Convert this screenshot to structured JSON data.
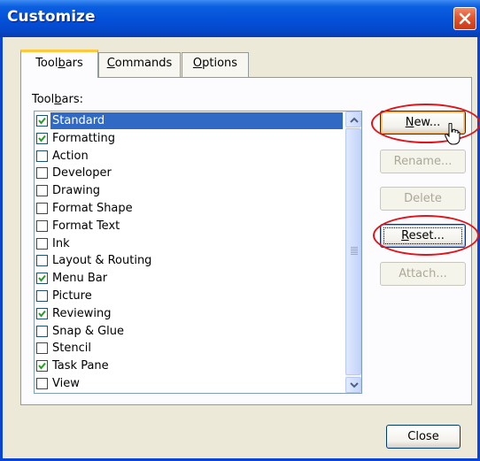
{
  "window": {
    "title": "Customize"
  },
  "tabs": [
    {
      "label_pre": "Tool",
      "label_ul": "b",
      "label_post": "ars",
      "active": true
    },
    {
      "label_pre": "",
      "label_ul": "C",
      "label_post": "ommands",
      "active": false
    },
    {
      "label_pre": "",
      "label_ul": "O",
      "label_post": "ptions",
      "active": false
    }
  ],
  "panel": {
    "list_label_pre": "Tool",
    "list_label_ul": "b",
    "list_label_post": "ars:"
  },
  "toolbars": [
    {
      "label": "Standard",
      "checked": true,
      "selected": true
    },
    {
      "label": "Formatting",
      "checked": true
    },
    {
      "label": "Action",
      "checked": false
    },
    {
      "label": "Developer",
      "checked": false
    },
    {
      "label": "Drawing",
      "checked": false
    },
    {
      "label": "Format Shape",
      "checked": false
    },
    {
      "label": "Format Text",
      "checked": false
    },
    {
      "label": "Ink",
      "checked": false
    },
    {
      "label": "Layout & Routing",
      "checked": false
    },
    {
      "label": "Menu Bar",
      "checked": true
    },
    {
      "label": "Picture",
      "checked": false
    },
    {
      "label": "Reviewing",
      "checked": true
    },
    {
      "label": "Snap & Glue",
      "checked": false
    },
    {
      "label": "Stencil",
      "checked": false
    },
    {
      "label": "Task Pane",
      "checked": true
    },
    {
      "label": "View",
      "checked": false
    }
  ],
  "buttons": {
    "new_ul": "N",
    "new_post": "ew...",
    "rename": "Rename...",
    "delete": "Delete",
    "reset_ul": "R",
    "reset_post": "eset...",
    "attach": "Attach...",
    "close": "Close"
  },
  "colors": {
    "title_bar": "#0450d8",
    "selection": "#316ac5",
    "highlight_ellipse": "#e0141a",
    "check": "#21a121"
  }
}
